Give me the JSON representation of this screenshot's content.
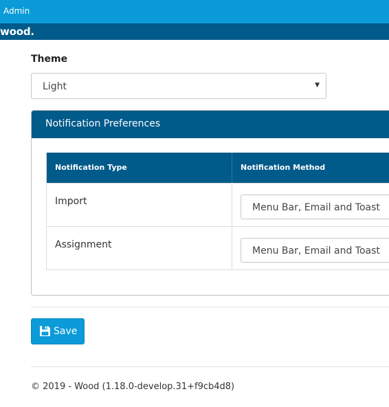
{
  "topbar": {
    "link_label": "Admin"
  },
  "brand": {
    "name": "wood",
    "dot": "."
  },
  "theme": {
    "label": "Theme",
    "selected": "Light"
  },
  "panel": {
    "title": "Notification Preferences"
  },
  "table": {
    "headers": [
      "Notification Type",
      "Notification Method"
    ],
    "rows": [
      {
        "type": "Import",
        "method": "Menu Bar, Email and Toast"
      },
      {
        "type": "Assignment",
        "method": "Menu Bar, Email and Toast"
      }
    ]
  },
  "actions": {
    "save_label": "Save",
    "save_icon": "floppy-disk-icon"
  },
  "footer": {
    "text": "© 2019 - Wood (1.18.0-develop.31+f9cb4d8)"
  },
  "colors": {
    "accent": "#0a9bd8",
    "header_dark": "#005a8a",
    "border": "#c7c7c7"
  }
}
